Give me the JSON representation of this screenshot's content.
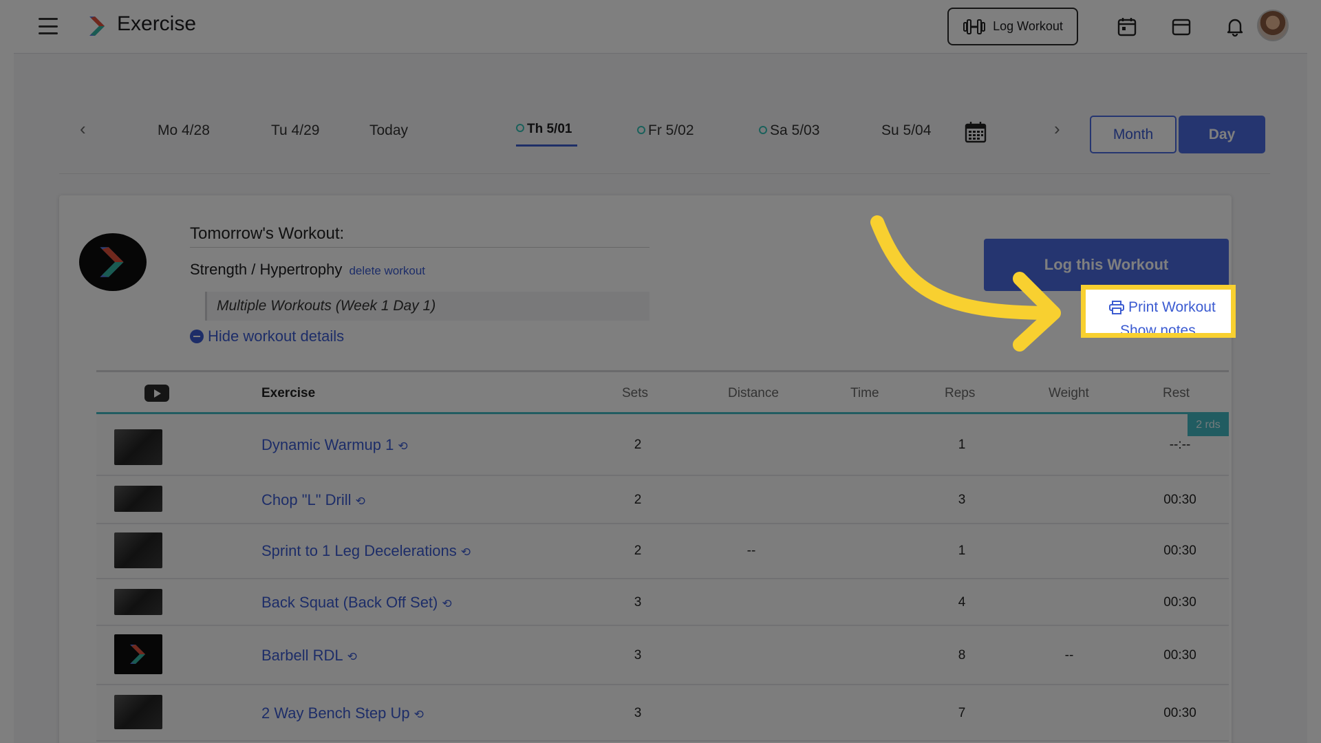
{
  "app": {
    "title": "Exercise"
  },
  "topbar": {
    "log_workout_label": "Log Workout"
  },
  "date_nav": {
    "days": [
      {
        "label": "Mo 4/28",
        "ring": false
      },
      {
        "label": "Tu 4/29",
        "ring": false
      },
      {
        "label": "Today",
        "ring": false
      },
      {
        "label": "Th 5/01",
        "ring": true
      },
      {
        "label": "Fr 5/02",
        "ring": true
      },
      {
        "label": "Sa 5/03",
        "ring": true
      },
      {
        "label": "Su 5/04",
        "ring": false
      }
    ],
    "month_label": "Month",
    "day_label": "Day"
  },
  "workout": {
    "heading": "Tomorrow's Workout:",
    "type": "Strength / Hypertrophy",
    "delete_label": "delete workout",
    "subtitle": "Multiple Workouts (Week 1 Day 1)",
    "hide_details": "Hide workout details",
    "log_button": "Log this Workout",
    "print_label": "Print Workout",
    "notes_label": "Show notes"
  },
  "table": {
    "headers": {
      "exercise": "Exercise",
      "sets": "Sets",
      "distance": "Distance",
      "time": "Time",
      "reps": "Reps",
      "weight": "Weight",
      "rest": "Rest"
    },
    "rounds_badge": "2 rds",
    "rows": [
      {
        "exercise": "Dynamic Warmup 1",
        "sets": "2",
        "distance": "",
        "time": "",
        "reps": "1",
        "weight": "",
        "rest": "--:--"
      },
      {
        "exercise": "Chop \"L\" Drill",
        "sets": "2",
        "distance": "",
        "time": "",
        "reps": "3",
        "weight": "",
        "rest": "00:30"
      },
      {
        "exercise": "Sprint to 1 Leg Decelerations",
        "sets": "2",
        "distance": "--",
        "time": "",
        "reps": "1",
        "weight": "",
        "rest": "00:30"
      },
      {
        "exercise": "Back Squat (Back Off Set)",
        "sets": "3",
        "distance": "",
        "time": "",
        "reps": "4",
        "weight": "",
        "rest": "00:30"
      },
      {
        "exercise": "Barbell RDL",
        "sets": "3",
        "distance": "",
        "time": "",
        "reps": "8",
        "weight": "--",
        "rest": "00:30"
      },
      {
        "exercise": "2 Way Bench Step Up",
        "sets": "3",
        "distance": "",
        "time": "",
        "reps": "7",
        "weight": "",
        "rest": "00:30"
      }
    ]
  },
  "colors": {
    "accent": "#4a6be0",
    "teal": "#43b8c2",
    "highlight": "#f8d030"
  }
}
